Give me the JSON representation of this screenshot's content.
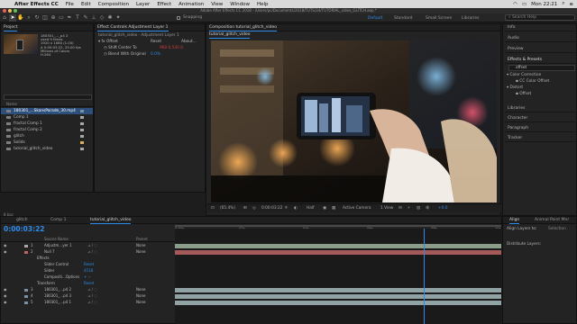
{
  "menubar": {
    "app": "After Effects CC",
    "items": [
      "File",
      "Edit",
      "Composition",
      "Layer",
      "Effect",
      "Animation",
      "View",
      "Window",
      "Help"
    ],
    "clock": "Mon 22:21"
  },
  "titlebar": "Adobe After Effects CC 2018 - /Users/pc/Documents/2018/TUTS/34/TUTORIAL_video_GLITCH.aep *",
  "toolbar": {
    "snapping": "Snapping",
    "workspaces": [
      "Default",
      "Standard",
      "Small Screen",
      "Libraries"
    ],
    "search_placeholder": "Search Help"
  },
  "project": {
    "tab": "Project",
    "info": [
      "180301_..._p4 2",
      "used 9 times",
      "1920 x 1080 (1.00)",
      "Δ 0:00:03:22, 25.00 fps",
      "Millions of Colors",
      "H.264"
    ],
    "items": [
      {
        "name": "180301_...SkansParade_30.mp4",
        "sel": true,
        "color": "#7b8fa6"
      },
      {
        "name": "Comp 1",
        "sel": false,
        "color": "#a8a8a8"
      },
      {
        "name": "fractal Comp 1",
        "sel": false,
        "color": "#a8a8a8"
      },
      {
        "name": "fractal Comp 2",
        "sel": false,
        "color": "#a8a8a8"
      },
      {
        "name": "glitch",
        "sel": false,
        "color": "#a8a8a8"
      },
      {
        "name": "Solids",
        "sel": false,
        "color": "#d4b15a"
      },
      {
        "name": "tutorial_glitch_video",
        "sel": false,
        "color": "#a8a8a8"
      }
    ],
    "footer": "8 bpc"
  },
  "effect_controls": {
    "tab": "Effect Controls Adjustment Layer 1",
    "subtitle": "tutorial_glitch_video · Adjustment Layer 1",
    "effect_name": "Offset",
    "reset": "Reset",
    "about": "About...",
    "props": [
      {
        "name": "Shift Center To",
        "value": "960.0,540.0"
      },
      {
        "name": "Blend With Original",
        "value": "0.0%"
      }
    ]
  },
  "composition": {
    "tab": "Composition tutorial_glitch_video",
    "subtab": "tutorial_glitch_video",
    "footer": {
      "zoom": "(65.4%)",
      "timecode": "0:00:03:22",
      "resolution": "Half",
      "camera": "Active Camera",
      "view": "1 View",
      "exposure": "+0.0"
    }
  },
  "right_panels": {
    "items": [
      "Info",
      "Audio",
      "Preview",
      "Effects & Presets",
      "Libraries",
      "Character",
      "Paragraph",
      "Tracker"
    ],
    "fx_search": "offset",
    "fx_tree": [
      "Color Correction",
      "CC Color Offset",
      "Distort",
      "Offset"
    ]
  },
  "timeline": {
    "tabs": [
      "glitch",
      "Comp 1",
      "tutorial_glitch_video"
    ],
    "timecode": "0:00:03:22",
    "col_source": "Source Name",
    "col_parent": "Parent",
    "ruler": [
      "0:00s",
      "02s",
      "04s",
      "06s",
      "08s",
      "10s"
    ],
    "layers": [
      {
        "num": "1",
        "name": "Adjustm...yer 1",
        "parent": "None",
        "color": "#a8a8a8"
      },
      {
        "num": "2",
        "name": "Null 7",
        "parent": "None",
        "color": "#c06060"
      }
    ],
    "sub": [
      {
        "name": "Effects",
        "val": ""
      },
      {
        "name": "Slider Control",
        "val": "Reset"
      },
      {
        "name": "Slider",
        "val": "4518"
      },
      {
        "name": "Compositi...Options",
        "val": "+ −"
      },
      {
        "name": "Transform",
        "val": "Reset"
      }
    ],
    "more_layers": [
      {
        "num": "3",
        "name": "180301_...p4 2",
        "parent": "None"
      },
      {
        "num": "4",
        "name": "180301_...p4 3",
        "parent": "None"
      },
      {
        "num": "5",
        "name": "180301_...p4 1",
        "parent": "None"
      }
    ]
  },
  "align": {
    "tabs": [
      "Align",
      "Layers"
    ],
    "tab2": "Animal Point Mnr",
    "align_to": "Align Layers to:",
    "selection": "Selection",
    "distribute": "Distribute Layers:"
  }
}
